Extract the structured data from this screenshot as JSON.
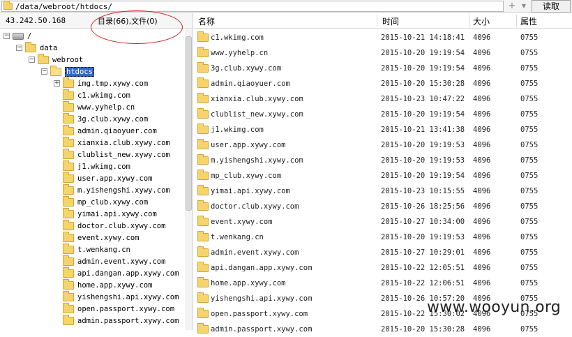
{
  "toolbar": {
    "path": "/data/webroot/htdocs/",
    "read_label": "读取",
    "plus_icon": "plus-icon",
    "dropdown_icon": "chevron-down-icon"
  },
  "left": {
    "ip": "43.242.50.168",
    "counts": "目录(66),文件(0)",
    "tree": [
      {
        "label": "/",
        "depth": 0,
        "kind": "drive",
        "expander": "−"
      },
      {
        "label": "data",
        "depth": 1,
        "kind": "folder",
        "expander": "−"
      },
      {
        "label": "webroot",
        "depth": 2,
        "kind": "folder",
        "expander": "−"
      },
      {
        "label": "htdocs",
        "depth": 3,
        "kind": "folder-open",
        "expander": "−",
        "selected": true
      },
      {
        "label": "img.tmp.xywy.com",
        "depth": 4,
        "kind": "folder",
        "expander": "+"
      },
      {
        "label": "c1.wkimg.com",
        "depth": 4,
        "kind": "folder"
      },
      {
        "label": "www.yyhelp.cn",
        "depth": 4,
        "kind": "folder"
      },
      {
        "label": "3g.club.xywy.com",
        "depth": 4,
        "kind": "folder"
      },
      {
        "label": "admin.qiaoyuer.com",
        "depth": 4,
        "kind": "folder"
      },
      {
        "label": "xianxia.club.xywy.com",
        "depth": 4,
        "kind": "folder"
      },
      {
        "label": "clublist_new.xywy.com",
        "depth": 4,
        "kind": "folder"
      },
      {
        "label": "j1.wkimg.com",
        "depth": 4,
        "kind": "folder"
      },
      {
        "label": "user.app.xywy.com",
        "depth": 4,
        "kind": "folder"
      },
      {
        "label": "m.yishengshi.xywy.com",
        "depth": 4,
        "kind": "folder"
      },
      {
        "label": "mp_club.xywy.com",
        "depth": 4,
        "kind": "folder"
      },
      {
        "label": "yimai.api.xywy.com",
        "depth": 4,
        "kind": "folder"
      },
      {
        "label": "doctor.club.xywy.com",
        "depth": 4,
        "kind": "folder"
      },
      {
        "label": "event.xywy.com",
        "depth": 4,
        "kind": "folder"
      },
      {
        "label": "t.wenkang.cn",
        "depth": 4,
        "kind": "folder"
      },
      {
        "label": "admin.event.xywy.com",
        "depth": 4,
        "kind": "folder"
      },
      {
        "label": "api.dangan.app.xywy.com",
        "depth": 4,
        "kind": "folder"
      },
      {
        "label": "home.app.xywy.com",
        "depth": 4,
        "kind": "folder"
      },
      {
        "label": "yishengshi.api.xywy.com",
        "depth": 4,
        "kind": "folder"
      },
      {
        "label": "open.passport.xywy.com",
        "depth": 4,
        "kind": "folder"
      },
      {
        "label": "admin.passport.xywy.com",
        "depth": 4,
        "kind": "folder"
      }
    ]
  },
  "right": {
    "columns": {
      "name": "名称",
      "time": "时间",
      "size": "大小",
      "attr": "属性"
    },
    "rows": [
      {
        "name": "c1.wkimg.com",
        "time": "2015-10-21 14:18:41",
        "size": "4096",
        "attr": "0755"
      },
      {
        "name": "www.yyhelp.cn",
        "time": "2015-10-20 19:19:54",
        "size": "4096",
        "attr": "0755"
      },
      {
        "name": "3g.club.xywy.com",
        "time": "2015-10-20 19:19:54",
        "size": "4096",
        "attr": "0755"
      },
      {
        "name": "admin.qiaoyuer.com",
        "time": "2015-10-20 15:30:28",
        "size": "4096",
        "attr": "0755"
      },
      {
        "name": "xianxia.club.xywy.com",
        "time": "2015-10-23 10:47:22",
        "size": "4096",
        "attr": "0755"
      },
      {
        "name": "clublist_new.xywy.com",
        "time": "2015-10-20 19:19:54",
        "size": "4096",
        "attr": "0755"
      },
      {
        "name": "j1.wkimg.com",
        "time": "2015-10-21 13:41:38",
        "size": "4096",
        "attr": "0755"
      },
      {
        "name": "user.app.xywy.com",
        "time": "2015-10-20 19:19:53",
        "size": "4096",
        "attr": "0755"
      },
      {
        "name": "m.yishengshi.xywy.com",
        "time": "2015-10-20 19:19:53",
        "size": "4096",
        "attr": "0755"
      },
      {
        "name": "mp_club.xywy.com",
        "time": "2015-10-20 19:19:54",
        "size": "4096",
        "attr": "0755"
      },
      {
        "name": "yimai.api.xywy.com",
        "time": "2015-10-23 10:15:55",
        "size": "4096",
        "attr": "0755"
      },
      {
        "name": "doctor.club.xywy.com",
        "time": "2015-10-26 18:25:56",
        "size": "4096",
        "attr": "0755"
      },
      {
        "name": "event.xywy.com",
        "time": "2015-10-27 10:34:00",
        "size": "4096",
        "attr": "0755"
      },
      {
        "name": "t.wenkang.cn",
        "time": "2015-10-20 19:19:53",
        "size": "4096",
        "attr": "0755"
      },
      {
        "name": "admin.event.xywy.com",
        "time": "2015-10-27 10:29:01",
        "size": "4096",
        "attr": "0755"
      },
      {
        "name": "api.dangan.app.xywy.com",
        "time": "2015-10-22 12:05:51",
        "size": "4096",
        "attr": "0755"
      },
      {
        "name": "home.app.xywy.com",
        "time": "2015-10-22 12:06:51",
        "size": "4096",
        "attr": "0755"
      },
      {
        "name": "yishengshi.api.xywy.com",
        "time": "2015-10-26 10:57:20",
        "size": "4096",
        "attr": "0755"
      },
      {
        "name": "open.passport.xywy.com",
        "time": "2015-10-22 15:30:02",
        "size": "4096",
        "attr": "0755"
      },
      {
        "name": "admin.passport.xywy.com",
        "time": "2015-10-20 15:30:28",
        "size": "4096",
        "attr": "0755"
      }
    ]
  },
  "watermark": "www.wooyun.org",
  "colors": {
    "selection": "#3068c8",
    "folder": "#f5d46b",
    "annotation": "#d82020"
  }
}
